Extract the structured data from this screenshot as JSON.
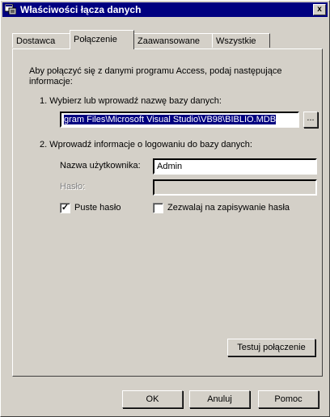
{
  "window": {
    "title": "Właściwości łącza danych",
    "close_label": "x"
  },
  "tabs": [
    {
      "label": "Dostawca"
    },
    {
      "label": "Połączenie"
    },
    {
      "label": "Zaawansowane"
    },
    {
      "label": "Wszystkie"
    }
  ],
  "connection": {
    "intro_line1": "Aby połączyć się z danymi programu Access, podaj następujące",
    "intro_line2": "informacje:",
    "step1_label": "1. Wybierz lub wprowadź nazwę bazy danych:",
    "database_path": "gram Files\\Microsoft Visual Studio\\VB98\\BIBLIO.MDB",
    "browse_label": "...",
    "step2_label": "2. Wprowadź informacje o logowaniu do bazy danych:",
    "username_label": "Nazwa użytkownika:",
    "username_value": "Admin",
    "password_label": "Hasło:",
    "password_value": "",
    "blank_password_label": "Puste hasło",
    "blank_password_checked": true,
    "allow_saving_label": "Zezwalaj na zapisywanie hasła",
    "allow_saving_checked": false,
    "test_label": "Testuj połączenie"
  },
  "footer": {
    "ok_label": "OK",
    "cancel_label": "Anuluj",
    "help_label": "Pomoc"
  }
}
